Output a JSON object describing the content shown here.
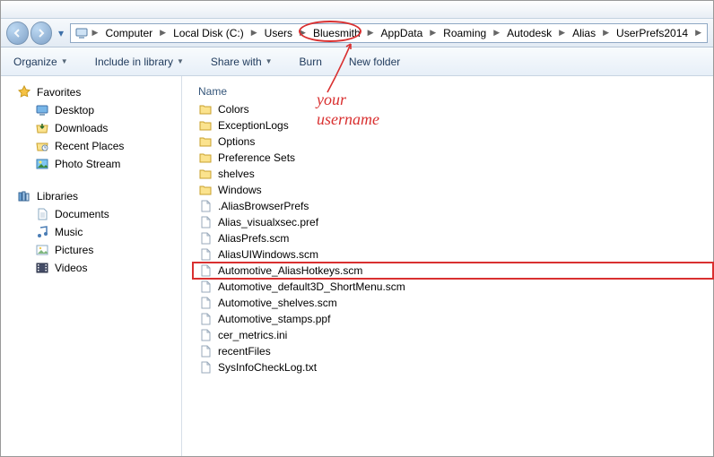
{
  "breadcrumb": {
    "items": [
      "Computer",
      "Local Disk (C:)",
      "Users",
      "Bluesmith",
      "AppData",
      "Roaming",
      "Autodesk",
      "Alias",
      "UserPrefs2014"
    ]
  },
  "toolbar": {
    "organize": "Organize",
    "include": "Include in library",
    "share": "Share with",
    "burn": "Burn",
    "newfolder": "New folder"
  },
  "nav": {
    "favorites": {
      "label": "Favorites",
      "items": [
        "Desktop",
        "Downloads",
        "Recent Places",
        "Photo Stream"
      ]
    },
    "libraries": {
      "label": "Libraries",
      "items": [
        "Documents",
        "Music",
        "Pictures",
        "Videos"
      ]
    }
  },
  "filepane": {
    "col_name": "Name",
    "folders": [
      "Colors",
      "ExceptionLogs",
      "Options",
      "Preference Sets",
      "shelves",
      "Windows"
    ],
    "files": [
      ".AliasBrowserPrefs",
      "Alias_visualxsec.pref",
      "AliasPrefs.scm",
      "AliasUIWindows.scm",
      "Automotive_AliasHotkeys.scm",
      "Automotive_default3D_ShortMenu.scm",
      "Automotive_shelves.scm",
      "Automotive_stamps.ppf",
      "cer_metrics.ini",
      "recentFiles",
      "SysInfoCheckLog.txt"
    ],
    "highlighted_index": 4
  },
  "annotation": {
    "line1": "your",
    "line2": "username"
  }
}
